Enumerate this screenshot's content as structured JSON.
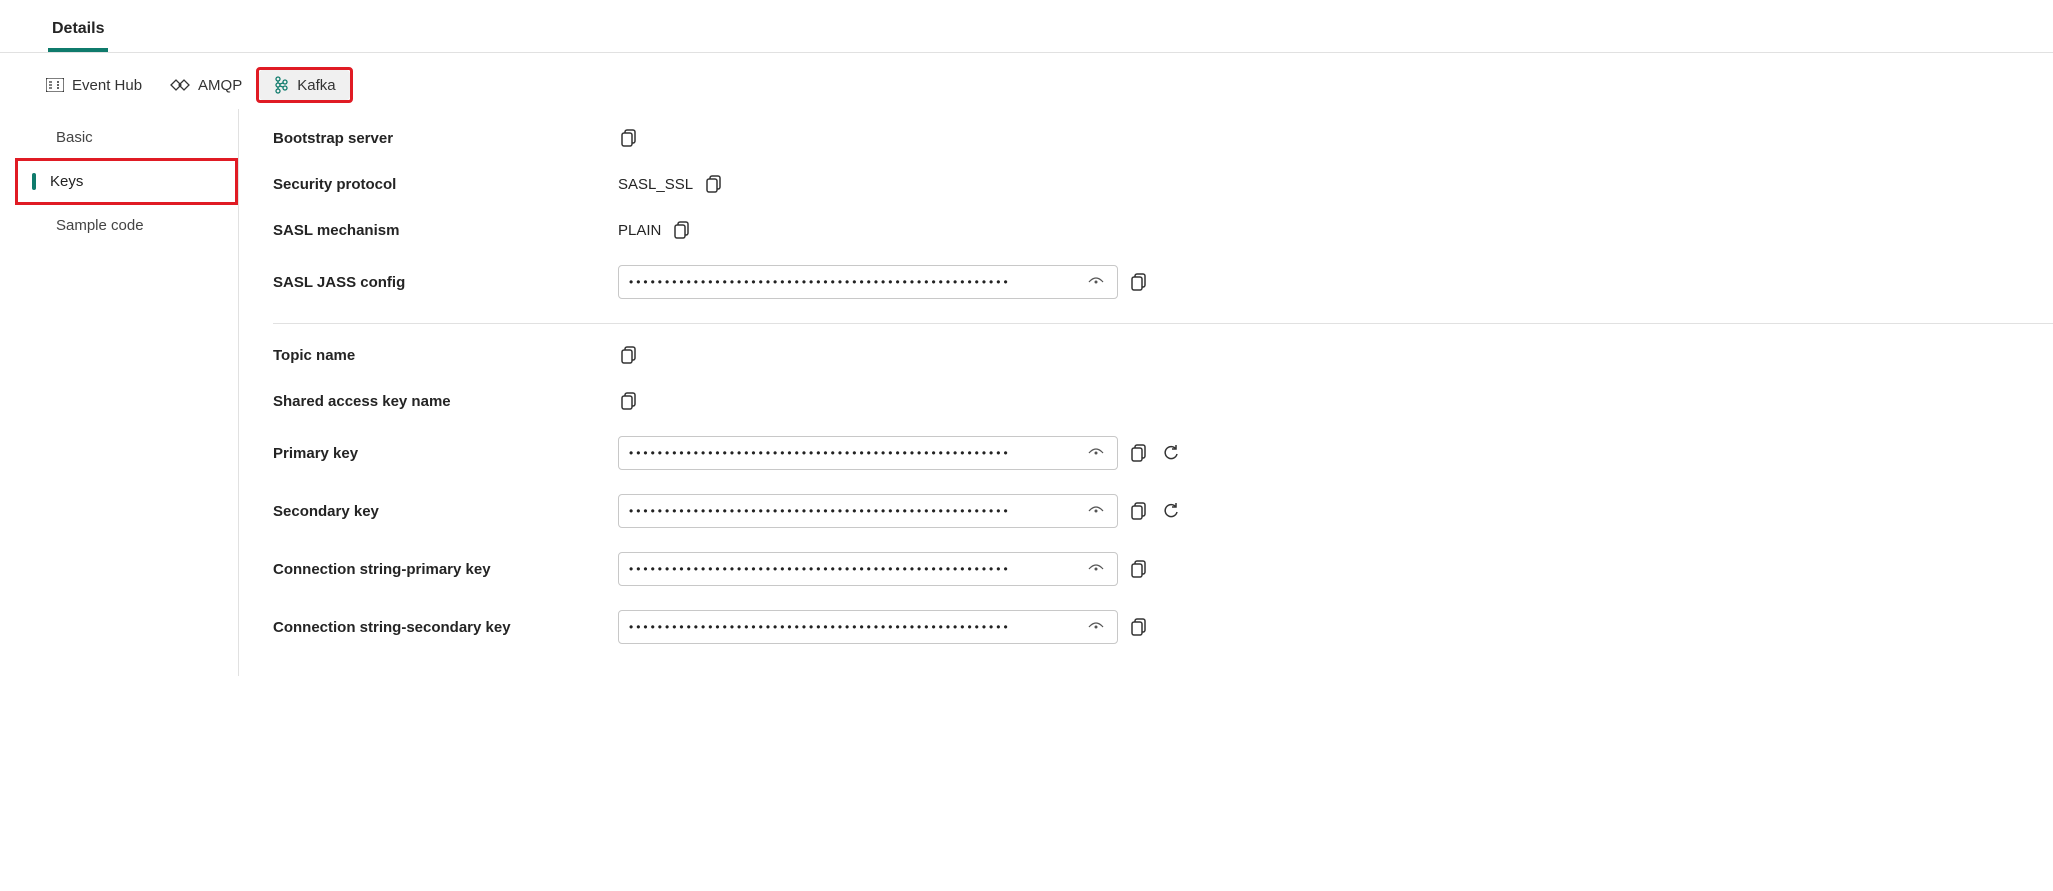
{
  "topTabs": {
    "details": "Details"
  },
  "protoTabs": {
    "eventHub": "Event Hub",
    "amqp": "AMQP",
    "kafka": "Kafka"
  },
  "nav": {
    "basic": "Basic",
    "keys": "Keys",
    "sampleCode": "Sample code"
  },
  "labels": {
    "bootstrapServer": "Bootstrap server",
    "securityProtocol": "Security protocol",
    "saslMechanism": "SASL mechanism",
    "saslJassConfig": "SASL JASS config",
    "topicName": "Topic name",
    "sharedAccessKeyName": "Shared access key name",
    "primaryKey": "Primary key",
    "secondaryKey": "Secondary key",
    "connStringPrimary": "Connection string-primary key",
    "connStringSecondary": "Connection string-secondary key"
  },
  "values": {
    "securityProtocol": "SASL_SSL",
    "saslMechanism": "PLAIN",
    "maskedShort": "•••••••••••••••••••••••••••••••••••••••••••••••••••••",
    "maskedLong": "•••••••••••••••••••••••••••••••••••••••••••••••••••••"
  }
}
